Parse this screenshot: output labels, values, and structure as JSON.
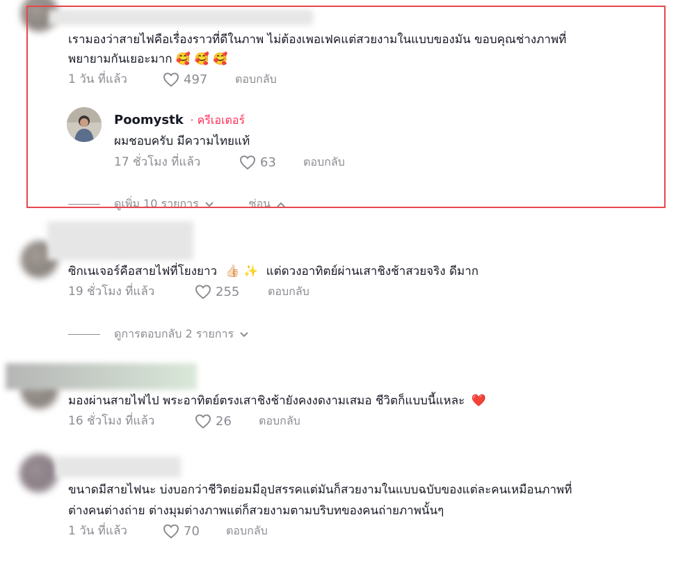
{
  "comments": [
    {
      "text_line1": "เรามองว่าสายไฟคือเรื่องราวที่ดีในภาพ ไม่ต้องเพอเฟคแต่สวยงามในแบบของมัน ขอบคุณช่างภาพที่",
      "text_line2": "พยายามกันเยอะมาก",
      "emoji": "🥰 🥰 🥰",
      "time": "1 วัน ที่แล้ว",
      "likes": "497",
      "reply_label": "ตอบกลับ",
      "creator_reply": {
        "username": "Poomystk",
        "badge": "· ครีเอเตอร์",
        "text": "ผมชอบครับ มีความไทยแท้",
        "time": "17 ชั่วโมง ที่แล้ว",
        "likes": "63",
        "reply_label": "ตอบกลับ"
      },
      "thread_more": "ดูเพิ่ม 10 รายการ",
      "thread_hide": "ซ่อน"
    },
    {
      "text": "ซิกเนเจอร์คือสายไฟที่โยงยาว",
      "text_rest": "แต่ดวงอาทิตย์ผ่านเสาชิงช้าสวยจริง ดีมาก",
      "emoji": "👍🏻 ✨",
      "time": "19 ชั่วโมง ที่แล้ว",
      "likes": "255",
      "reply_label": "ตอบกลับ",
      "thread_more": "ดูการตอบกลับ 2 รายการ"
    },
    {
      "text": "มองผ่านสายไฟไป พระอาทิตย์ตรงเสาชิงช้ายังคงงดงามเสมอ ชีวิตก็แบบนี้แหละ",
      "emoji": "❤️",
      "time": "16 ชั่วโมง ที่แล้ว",
      "likes": "26",
      "reply_label": "ตอบกลับ"
    },
    {
      "text_line1": "ขนาดมีสายไฟนะ บ่งบอกว่าชีวิตย่อมมีอุปสรรคแต่มันก็สวยงามในแบบฉบับของแต่ละคนเหมือนภาพที่",
      "text_line2": "ต่างคนต่างถ่าย ต่างมุมต่างภาพแต่ก็สวยงามตามบริบทของคนถ่ายภาพนั้นๆ",
      "time": "1 วัน ที่แล้ว",
      "likes": "70",
      "reply_label": "ตอบกลับ"
    }
  ],
  "colors": {
    "creator_badge": "#fe2c55",
    "highlight_border": "#e8464b",
    "meta_gray": "#8a8b91"
  }
}
